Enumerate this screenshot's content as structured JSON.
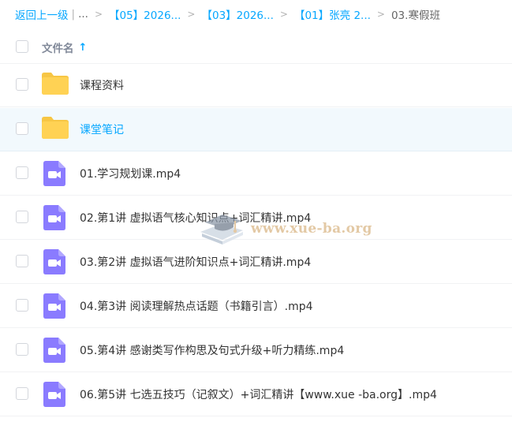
{
  "breadcrumb": {
    "back": "返回上一级",
    "separator": "|",
    "ellipsis": "...",
    "crumbs": [
      "【05】2026...",
      "【03】2026...",
      "【01】张亮 2..."
    ],
    "current": "03.寒假班"
  },
  "header": {
    "column_label": "文件名",
    "sort_icon": "arrow-up-icon"
  },
  "files": [
    {
      "type": "folder",
      "icon": "folder-icon",
      "name": "课程资料"
    },
    {
      "type": "folder",
      "icon": "folder-icon",
      "name": "课堂笔记",
      "hovered": true
    },
    {
      "type": "video",
      "icon": "video-file-icon",
      "name": "01.学习规划课.mp4"
    },
    {
      "type": "video",
      "icon": "video-file-icon",
      "name": "02.第1讲 虚拟语气核心知识点+词汇精讲.mp4"
    },
    {
      "type": "video",
      "icon": "video-file-icon",
      "name": "03.第2讲 虚拟语气进阶知识点+词汇精讲.mp4"
    },
    {
      "type": "video",
      "icon": "video-file-icon",
      "name": "04.第3讲 阅读理解热点话题（书籍引言）.mp4"
    },
    {
      "type": "video",
      "icon": "video-file-icon",
      "name": "05.第4讲 感谢类写作构思及句式升级+听力精练.mp4"
    },
    {
      "type": "video",
      "icon": "video-file-icon",
      "name": "06.第5讲 七选五技巧（记叙文）+词汇精讲【www.xue -ba.org】.mp4"
    }
  ],
  "watermark": {
    "text": "www.xue-ba.org",
    "icon": "graduation-cap-book-icon"
  },
  "colors": {
    "accent": "#06a7ff",
    "folder": "#ffd254",
    "video": "#8a7bff",
    "hover_row": "#f2f9fd"
  }
}
